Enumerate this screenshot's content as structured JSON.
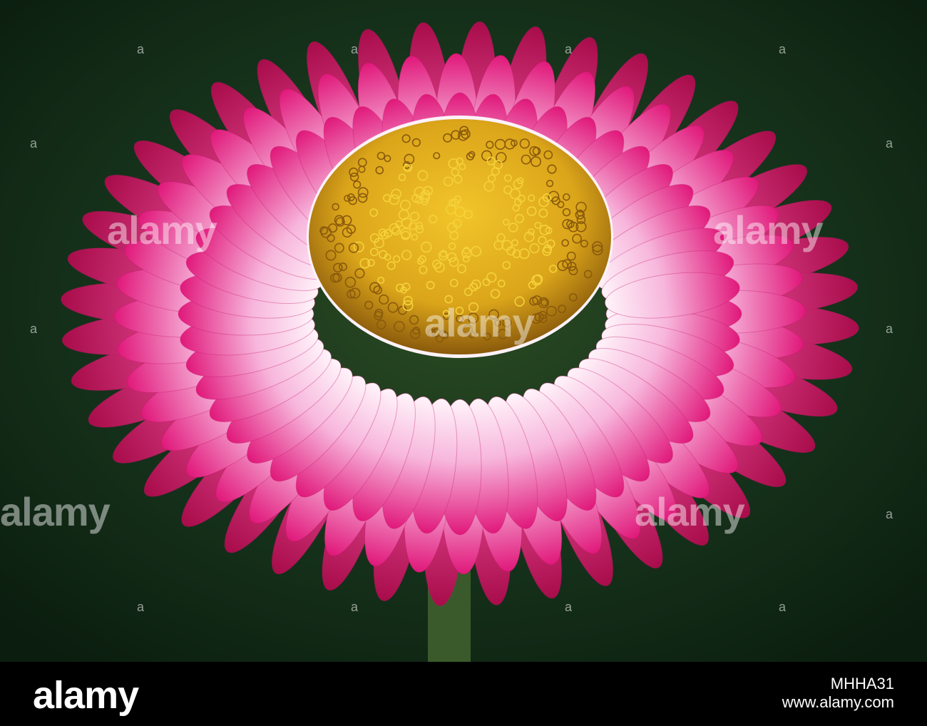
{
  "photo": {
    "subject": "pink-white strawflower with yellow center",
    "colors": {
      "background": "#14301a",
      "petal_tip": "#e0187a",
      "petal_base": "#fbe9f4",
      "center": "#e0b020",
      "center_dark": "#9a6a10",
      "stem": "#3a5a2a"
    }
  },
  "watermark": {
    "word": "alamy",
    "mark_glyph": "a"
  },
  "footer": {
    "logo_text": "alamy",
    "image_id": "MHHA31",
    "url": "www.alamy.com"
  }
}
